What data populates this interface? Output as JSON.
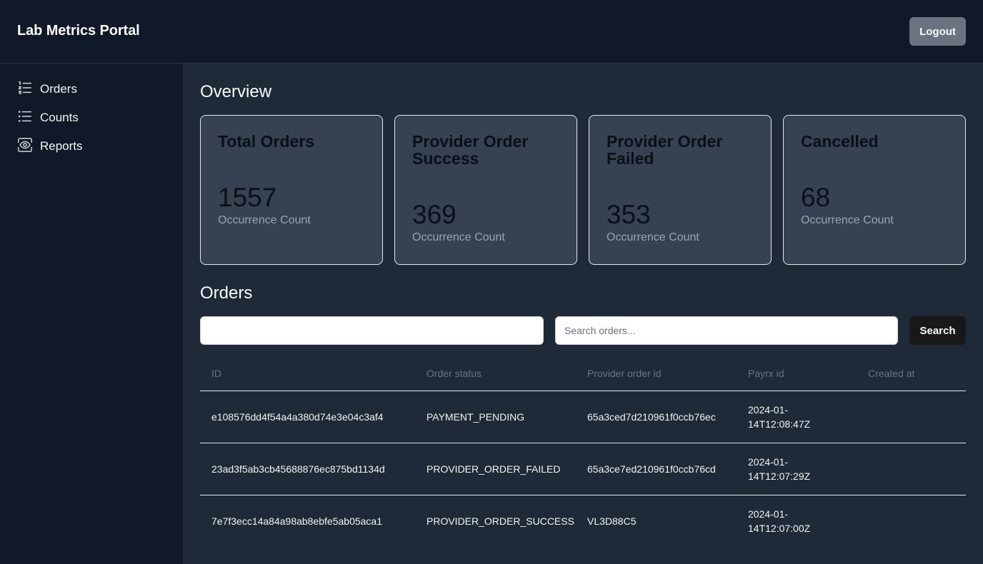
{
  "header": {
    "title": "Lab Metrics Portal",
    "logout_label": "Logout"
  },
  "sidebar": {
    "items": [
      {
        "label": "Orders",
        "icon": "ordered-list-icon"
      },
      {
        "label": "Counts",
        "icon": "list-icon"
      },
      {
        "label": "Reports",
        "icon": "eye-icon"
      }
    ]
  },
  "overview": {
    "title": "Overview",
    "cards": [
      {
        "title": "Total Orders",
        "value": "1557",
        "subtitle": "Occurrence Count"
      },
      {
        "title": "Provider Order Success",
        "value": "369",
        "subtitle": "Occurrence Count"
      },
      {
        "title": "Provider Order Failed",
        "value": "353",
        "subtitle": "Occurrence Count"
      },
      {
        "title": "Cancelled",
        "value": "68",
        "subtitle": "Occurrence Count"
      }
    ]
  },
  "orders": {
    "title": "Orders",
    "filter_value": "",
    "search_placeholder": "Search orders...",
    "search_label": "Search",
    "columns": [
      "ID",
      "Order status",
      "Provider order id",
      "Payrx id",
      "Created at"
    ],
    "rows": [
      {
        "id": "e108576dd4f54a4a380d74e3e04c3af4",
        "status": "PAYMENT_PENDING",
        "provider_order_id": "65a3ced7d210961f0ccb76ec",
        "payrx_id": "2024-01-14T12:08:47Z",
        "created_at": ""
      },
      {
        "id": "23ad3f5ab3cb45688876ec875bd1134d",
        "status": "PROVIDER_ORDER_FAILED",
        "provider_order_id": "65a3ce7ed210961f0ccb76cd",
        "payrx_id": "2024-01-14T12:07:29Z",
        "created_at": ""
      },
      {
        "id": "7e7f3ecc14a84a98ab8ebfe5ab05aca1",
        "status": "PROVIDER_ORDER_SUCCESS",
        "provider_order_id": "VL3D88C5",
        "payrx_id": "2024-01-14T12:07:00Z",
        "created_at": ""
      }
    ]
  },
  "colors": {
    "page_bg": "#111827",
    "main_bg": "#1f2937",
    "card_bg": "#374151",
    "logout_bg": "#6b7280",
    "search_button_bg": "#18181b"
  }
}
